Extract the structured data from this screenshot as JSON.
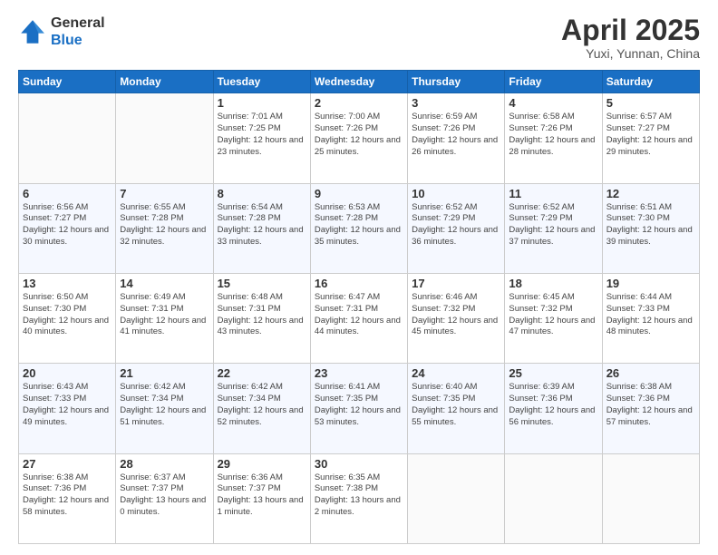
{
  "header": {
    "logo_general": "General",
    "logo_blue": "Blue",
    "title": "April 2025",
    "location": "Yuxi, Yunnan, China"
  },
  "weekdays": [
    "Sunday",
    "Monday",
    "Tuesday",
    "Wednesday",
    "Thursday",
    "Friday",
    "Saturday"
  ],
  "weeks": [
    [
      {
        "day": "",
        "info": ""
      },
      {
        "day": "",
        "info": ""
      },
      {
        "day": "1",
        "info": "Sunrise: 7:01 AM\nSunset: 7:25 PM\nDaylight: 12 hours and 23 minutes."
      },
      {
        "day": "2",
        "info": "Sunrise: 7:00 AM\nSunset: 7:26 PM\nDaylight: 12 hours and 25 minutes."
      },
      {
        "day": "3",
        "info": "Sunrise: 6:59 AM\nSunset: 7:26 PM\nDaylight: 12 hours and 26 minutes."
      },
      {
        "day": "4",
        "info": "Sunrise: 6:58 AM\nSunset: 7:26 PM\nDaylight: 12 hours and 28 minutes."
      },
      {
        "day": "5",
        "info": "Sunrise: 6:57 AM\nSunset: 7:27 PM\nDaylight: 12 hours and 29 minutes."
      }
    ],
    [
      {
        "day": "6",
        "info": "Sunrise: 6:56 AM\nSunset: 7:27 PM\nDaylight: 12 hours and 30 minutes."
      },
      {
        "day": "7",
        "info": "Sunrise: 6:55 AM\nSunset: 7:28 PM\nDaylight: 12 hours and 32 minutes."
      },
      {
        "day": "8",
        "info": "Sunrise: 6:54 AM\nSunset: 7:28 PM\nDaylight: 12 hours and 33 minutes."
      },
      {
        "day": "9",
        "info": "Sunrise: 6:53 AM\nSunset: 7:28 PM\nDaylight: 12 hours and 35 minutes."
      },
      {
        "day": "10",
        "info": "Sunrise: 6:52 AM\nSunset: 7:29 PM\nDaylight: 12 hours and 36 minutes."
      },
      {
        "day": "11",
        "info": "Sunrise: 6:52 AM\nSunset: 7:29 PM\nDaylight: 12 hours and 37 minutes."
      },
      {
        "day": "12",
        "info": "Sunrise: 6:51 AM\nSunset: 7:30 PM\nDaylight: 12 hours and 39 minutes."
      }
    ],
    [
      {
        "day": "13",
        "info": "Sunrise: 6:50 AM\nSunset: 7:30 PM\nDaylight: 12 hours and 40 minutes."
      },
      {
        "day": "14",
        "info": "Sunrise: 6:49 AM\nSunset: 7:31 PM\nDaylight: 12 hours and 41 minutes."
      },
      {
        "day": "15",
        "info": "Sunrise: 6:48 AM\nSunset: 7:31 PM\nDaylight: 12 hours and 43 minutes."
      },
      {
        "day": "16",
        "info": "Sunrise: 6:47 AM\nSunset: 7:31 PM\nDaylight: 12 hours and 44 minutes."
      },
      {
        "day": "17",
        "info": "Sunrise: 6:46 AM\nSunset: 7:32 PM\nDaylight: 12 hours and 45 minutes."
      },
      {
        "day": "18",
        "info": "Sunrise: 6:45 AM\nSunset: 7:32 PM\nDaylight: 12 hours and 47 minutes."
      },
      {
        "day": "19",
        "info": "Sunrise: 6:44 AM\nSunset: 7:33 PM\nDaylight: 12 hours and 48 minutes."
      }
    ],
    [
      {
        "day": "20",
        "info": "Sunrise: 6:43 AM\nSunset: 7:33 PM\nDaylight: 12 hours and 49 minutes."
      },
      {
        "day": "21",
        "info": "Sunrise: 6:42 AM\nSunset: 7:34 PM\nDaylight: 12 hours and 51 minutes."
      },
      {
        "day": "22",
        "info": "Sunrise: 6:42 AM\nSunset: 7:34 PM\nDaylight: 12 hours and 52 minutes."
      },
      {
        "day": "23",
        "info": "Sunrise: 6:41 AM\nSunset: 7:35 PM\nDaylight: 12 hours and 53 minutes."
      },
      {
        "day": "24",
        "info": "Sunrise: 6:40 AM\nSunset: 7:35 PM\nDaylight: 12 hours and 55 minutes."
      },
      {
        "day": "25",
        "info": "Sunrise: 6:39 AM\nSunset: 7:36 PM\nDaylight: 12 hours and 56 minutes."
      },
      {
        "day": "26",
        "info": "Sunrise: 6:38 AM\nSunset: 7:36 PM\nDaylight: 12 hours and 57 minutes."
      }
    ],
    [
      {
        "day": "27",
        "info": "Sunrise: 6:38 AM\nSunset: 7:36 PM\nDaylight: 12 hours and 58 minutes."
      },
      {
        "day": "28",
        "info": "Sunrise: 6:37 AM\nSunset: 7:37 PM\nDaylight: 13 hours and 0 minutes."
      },
      {
        "day": "29",
        "info": "Sunrise: 6:36 AM\nSunset: 7:37 PM\nDaylight: 13 hours and 1 minute."
      },
      {
        "day": "30",
        "info": "Sunrise: 6:35 AM\nSunset: 7:38 PM\nDaylight: 13 hours and 2 minutes."
      },
      {
        "day": "",
        "info": ""
      },
      {
        "day": "",
        "info": ""
      },
      {
        "day": "",
        "info": ""
      }
    ]
  ]
}
